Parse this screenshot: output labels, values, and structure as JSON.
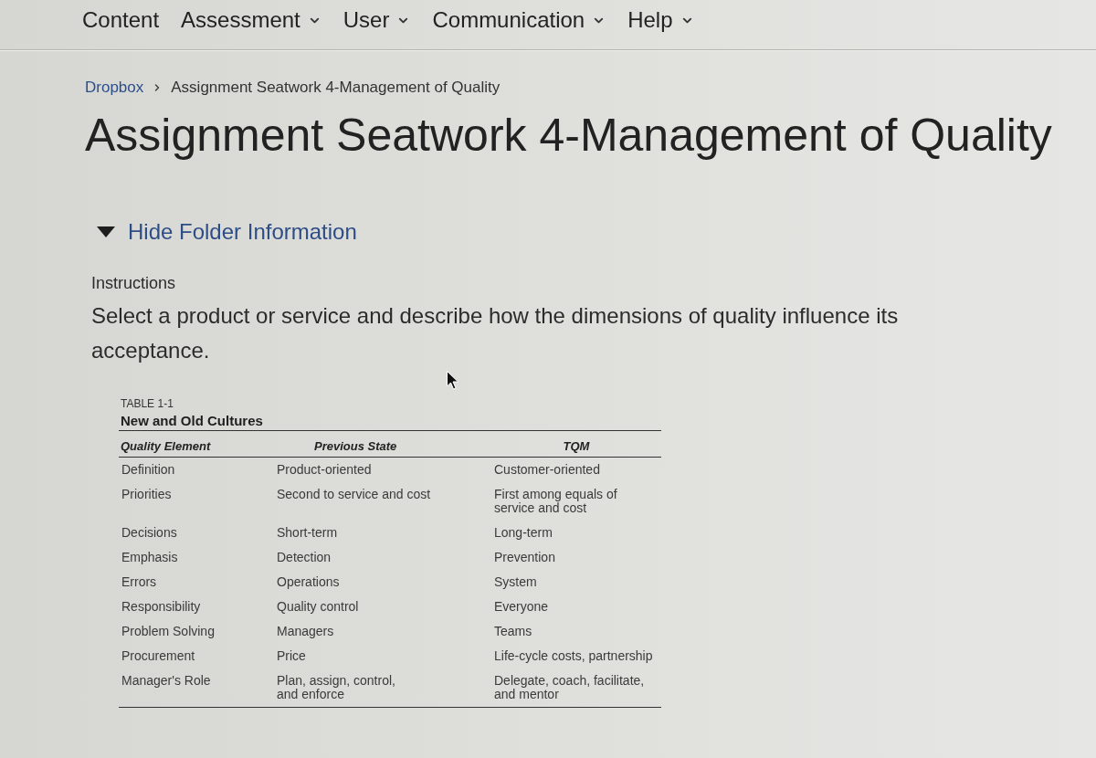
{
  "nav": {
    "items": [
      {
        "label": "Content",
        "has_menu": false
      },
      {
        "label": "Assessment",
        "has_menu": true
      },
      {
        "label": "User",
        "has_menu": true
      },
      {
        "label": "Communication",
        "has_menu": true
      },
      {
        "label": "Help",
        "has_menu": true
      }
    ]
  },
  "breadcrumb": [
    {
      "label": "Dropbox",
      "kind": "link"
    },
    {
      "label": "Assignment Seatwork 4-Management of Quality",
      "kind": "current"
    }
  ],
  "page_title": "Assignment Seatwork 4-Management of Quality",
  "folder_toggle": {
    "label": "Hide Folder Information",
    "expanded": true
  },
  "instructions": {
    "heading": "Instructions",
    "text": "Select a product or service and describe how the dimensions of quality influence its acceptance."
  },
  "table": {
    "number": "TABLE 1-1",
    "title": "New and Old Cultures",
    "columns": [
      "Quality Element",
      "Previous State",
      "TQM"
    ],
    "rows": [
      [
        "Definition",
        "Product-oriented",
        "Customer-oriented"
      ],
      [
        "Priorities",
        "Second to service and cost",
        "First among equals of\nservice and cost"
      ],
      [
        "Decisions",
        "Short-term",
        "Long-term"
      ],
      [
        "Emphasis",
        "Detection",
        "Prevention"
      ],
      [
        "Errors",
        "Operations",
        "System"
      ],
      [
        "Responsibility",
        "Quality control",
        "Everyone"
      ],
      [
        "Problem Solving",
        "Managers",
        "Teams"
      ],
      [
        "Procurement",
        "Price",
        "Life-cycle costs, partnership"
      ],
      [
        "Manager's Role",
        "Plan, assign, control,\nand enforce",
        "Delegate, coach, facilitate,\nand mentor"
      ]
    ]
  }
}
